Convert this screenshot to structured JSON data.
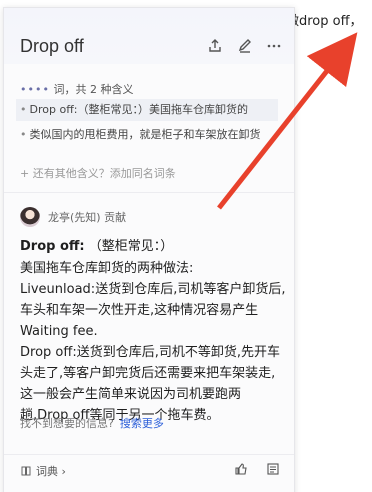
{
  "background": {
    "text": "做drop off，"
  },
  "header": {
    "title": "Drop off"
  },
  "meanings": {
    "header_dots": "••••",
    "header_text": "词，共 2 种含义",
    "items": [
      {
        "text": "Drop off:（整柜常见：）美国拖车仓库卸货的"
      },
      {
        "text": "类似国内的甩柜费用，就是柜子和车架放在卸货"
      }
    ],
    "add_text": "还有其他含义？添加同名词条"
  },
  "contributor": {
    "name": "龙亭(先知) 贡献"
  },
  "entry": {
    "term": "Drop off:",
    "subtitle": "（整柜常见：）",
    "lines": [
      "美国拖车仓库卸货的两种做法:",
      "Liveunload:送货到仓库后,司机等客户卸货后,",
      "车头和车架一次性开走,这种情况容易产生",
      "Waiting fee.",
      "Drop off:送货到仓库后,司机不等卸货,先开车",
      "头走了,等客户卸完货后还需要来把车架装走,",
      "这一般会产生简单来说因为司机要跑两",
      "趟,Drop off等同于另一个拖车费。"
    ]
  },
  "help": {
    "text": "找不到想要的信息?",
    "link": "搜索更多"
  },
  "footer": {
    "dict_label": "词典 ›"
  },
  "colors": {
    "arrow": "#e8412c",
    "link": "#2b5fd9"
  }
}
